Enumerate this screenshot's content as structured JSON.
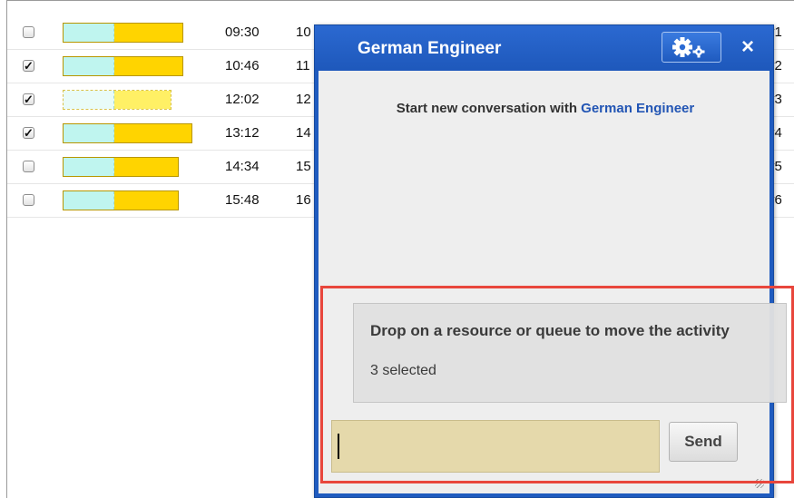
{
  "rows": [
    {
      "checked": false,
      "dim": false,
      "bar_fill": 0.62,
      "time": "09:30",
      "next": "10",
      "right": "y1"
    },
    {
      "checked": true,
      "dim": false,
      "bar_fill": 0.62,
      "time": "10:46",
      "next": "11",
      "right": "y2"
    },
    {
      "checked": true,
      "dim": true,
      "bar_fill": 0.62,
      "time": "12:02",
      "next": "12",
      "right": "y3"
    },
    {
      "checked": true,
      "dim": false,
      "bar_fill": 0.62,
      "time": "13:12",
      "next": "14",
      "right": "y4"
    },
    {
      "checked": false,
      "dim": false,
      "bar_fill": 0.62,
      "time": "14:34",
      "next": "15",
      "right": "y5"
    },
    {
      "checked": false,
      "dim": false,
      "bar_fill": 0.62,
      "time": "15:48",
      "next": "16",
      "right": "y6"
    }
  ],
  "chat": {
    "title": "German Engineer",
    "close_label": "×",
    "start_prefix": "Start new conversation with",
    "start_link": "German Engineer",
    "drop_message": "Drop on a resource or queue to move the activity",
    "drop_count": "3 selected",
    "input_value": "",
    "send_label": "Send"
  },
  "colors": {
    "chat_header": "#1f5bbf",
    "bar_teal": "#bff5ef",
    "bar_gold": "#ffd400",
    "input_bg": "#e5d9ab",
    "highlight": "#e8463c"
  },
  "icons": {
    "settings": "gear-icon",
    "close": "close-icon"
  }
}
